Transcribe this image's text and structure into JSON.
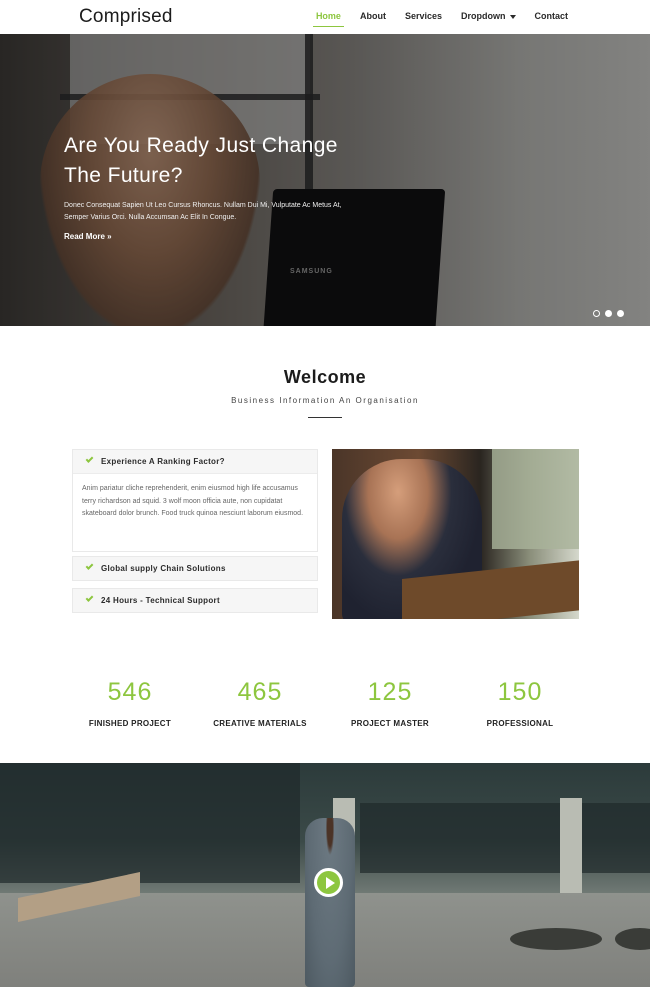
{
  "header": {
    "logo": "Comprised",
    "nav": [
      {
        "label": "Home",
        "active": true
      },
      {
        "label": "About"
      },
      {
        "label": "Services"
      },
      {
        "label": "Dropdown"
      },
      {
        "label": "Contact"
      }
    ]
  },
  "hero": {
    "title_line1": "Are You Ready Just Change",
    "title_line2": "The Future?",
    "text_line1": "Donec Consequat Sapien Ut Leo Cursus Rhoncus. Nullam Dui Mi, Vulputate Ac Metus At,",
    "text_line2": "Semper Varius Orci. Nulla Accumsan Ac Elit In Congue.",
    "read_more": "Read More »",
    "laptop_brand": "SAMSUNG",
    "slides": 3,
    "active_slide": 1
  },
  "welcome": {
    "title": "Welcome",
    "subtitle": "Business Information An Organisation"
  },
  "accordion": [
    {
      "title": "Experience A Ranking Factor?",
      "body": "Anim pariatur cliche reprehenderit, enim eiusmod high life accusamus terry richardson ad squid. 3 wolf moon officia aute, non cupidatat skateboard dolor brunch. Food truck quinoa nesciunt laborum eiusmod.",
      "open": true
    },
    {
      "title": "Global supply Chain Solutions"
    },
    {
      "title": "24 Hours - Technical Support"
    }
  ],
  "stats": [
    {
      "number": "546",
      "label": "FINISHED PROJECT"
    },
    {
      "number": "465",
      "label": "CREATIVE MATERIALS"
    },
    {
      "number": "125",
      "label": "PROJECT MASTER"
    },
    {
      "number": "150",
      "label": "PROFESSIONAL"
    }
  ],
  "colors": {
    "accent": "#8dc63f",
    "text": "#222222"
  }
}
